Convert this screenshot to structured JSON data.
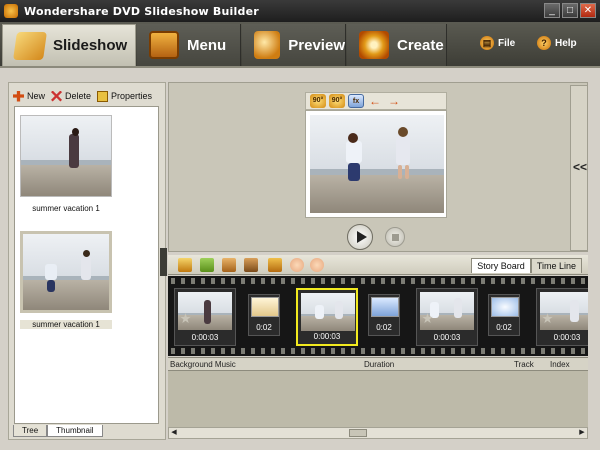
{
  "window": {
    "title": "Wondershare DVD Slideshow Builder",
    "min": "_",
    "max": "□",
    "close": "✕"
  },
  "main_tabs": [
    {
      "label": "Slideshow",
      "icon": "slideshow-icon"
    },
    {
      "label": "Menu",
      "icon": "menu-icon"
    },
    {
      "label": "Preview",
      "icon": "preview-icon"
    },
    {
      "label": "Create",
      "icon": "create-icon"
    }
  ],
  "side_buttons": {
    "file": "File",
    "help": "Help"
  },
  "left_panel": {
    "toolbar": {
      "new": "New",
      "delete": "Delete",
      "properties": "Properties"
    },
    "thumbnails": [
      {
        "caption": "summer vacation 1"
      },
      {
        "caption": "summer vacation 1"
      }
    ],
    "tabs": [
      "Tree",
      "Thumbnail"
    ]
  },
  "preview": {
    "tools": [
      "90°",
      "90°",
      "fx",
      "←",
      "→"
    ]
  },
  "storyboard": {
    "tabs": [
      "Story Board",
      "Time Line"
    ],
    "slides": [
      {
        "duration": "0:00:03"
      },
      {
        "duration": "0:00:03"
      },
      {
        "duration": "0:00:03"
      },
      {
        "duration": "0:00:03"
      }
    ],
    "transitions": [
      {
        "duration": "0:02"
      },
      {
        "duration": "0:02"
      },
      {
        "duration": "0:02"
      }
    ]
  },
  "sound_table": {
    "columns": [
      "Background Music",
      "Duration",
      "Track",
      "Index"
    ]
  }
}
